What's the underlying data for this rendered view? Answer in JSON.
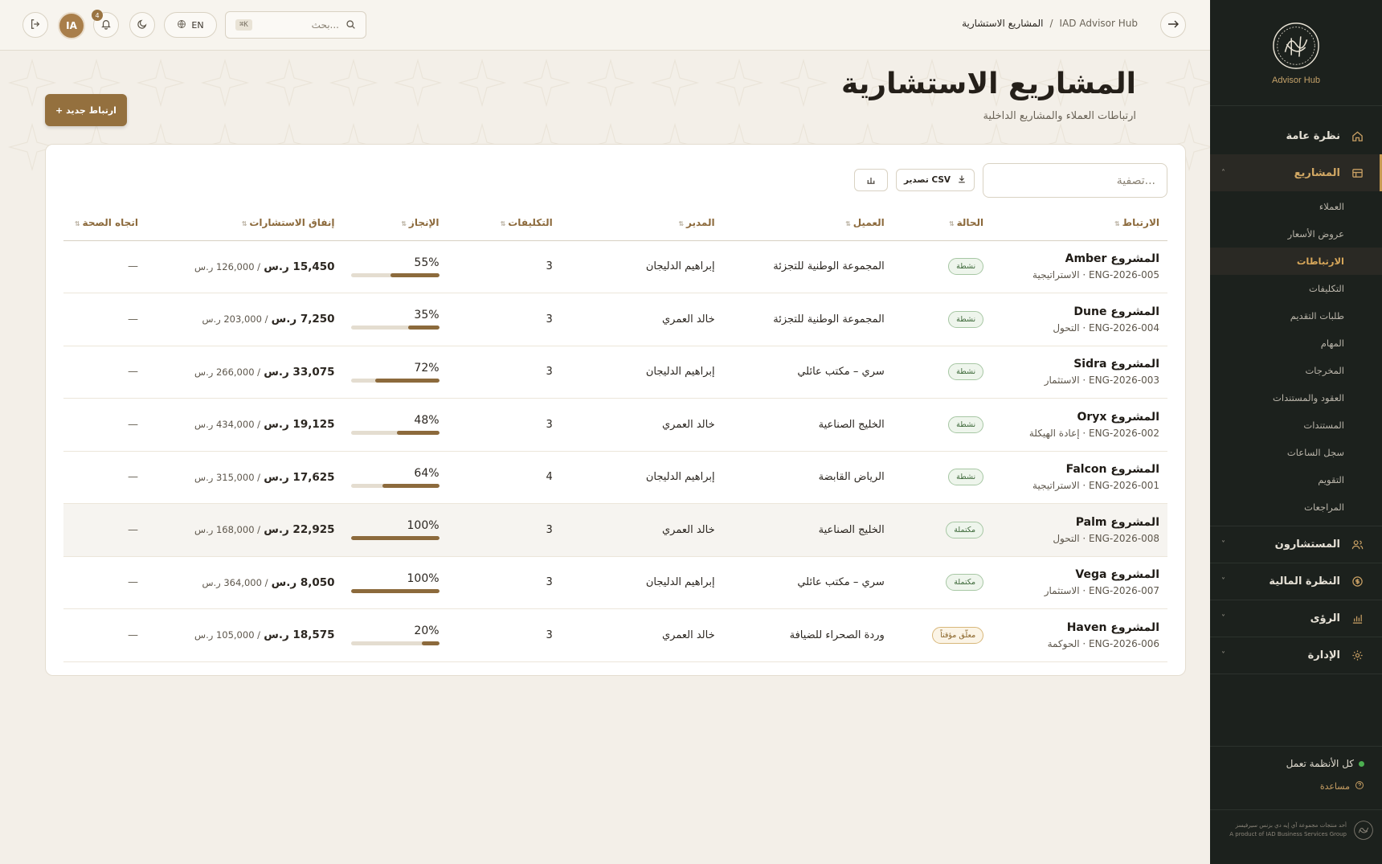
{
  "sidebar": {
    "brand_sub": "Advisor Hub",
    "nav": [
      {
        "label": "نظرة عامة",
        "icon": "home-icon"
      },
      {
        "label": "المشاريع",
        "icon": "projects-icon",
        "active": true
      }
    ],
    "sub_items": [
      {
        "label": "العملاء"
      },
      {
        "label": "عروض الأسعار"
      },
      {
        "label": "الارتباطات",
        "active": true
      },
      {
        "label": "التكليفات"
      },
      {
        "label": "طلبات التقديم"
      },
      {
        "label": "المهام"
      },
      {
        "label": "المخرجات"
      },
      {
        "label": "العقود والمستندات"
      },
      {
        "label": "المستندات"
      },
      {
        "label": "سجل الساعات"
      },
      {
        "label": "التقويم"
      },
      {
        "label": "المراجعات"
      }
    ],
    "groups": [
      {
        "label": "المستشارون",
        "icon": "users-icon"
      },
      {
        "label": "النظرة المالية",
        "icon": "finance-icon"
      },
      {
        "label": "الرؤى",
        "icon": "insights-icon"
      },
      {
        "label": "الإدارة",
        "icon": "admin-icon"
      }
    ],
    "status": "كل الأنظمة تعمل",
    "status_color": "#4caf50",
    "help": "مساعدة",
    "footer_ar": "أحد منتجات مجموعة آي إيه دي بزنس سيرفيسز",
    "footer_en": "A product of IAD Business Services Group"
  },
  "topbar": {
    "breadcrumb_root": "IAD Advisor Hub",
    "breadcrumb_sep": "/",
    "breadcrumb_current": "المشاريع الاستشارية",
    "search_placeholder": "بحث...",
    "search_shortcut": "⌘K",
    "lang": "EN",
    "notifications_count": "4",
    "avatar_initials": "IA"
  },
  "page": {
    "title": "المشاريع الاستشارية",
    "subtitle": "ارتباطات العملاء والمشاريع الداخلية",
    "new_button": "+ ارتباط جديد",
    "filter_placeholder": "تصفية...",
    "export_csv": "تصدير CSV"
  },
  "table": {
    "columns": [
      "الارتباط",
      "الحالة",
      "العميل",
      "المدير",
      "التكليفات",
      "الإنجاز",
      "إنفاق الاستشارات",
      "اتجاه الصحة"
    ],
    "rows": [
      {
        "name": "المشروع Amber",
        "meta": "ENG-2026-005 · الاستراتيجية",
        "status": "نشطة",
        "status_kind": "active",
        "client": "المجموعة الوطنية للتجزئة",
        "manager": "إبراهيم الدليجان",
        "assignments": "3",
        "progress": 55,
        "progress_label": "55%",
        "spend": "15,450 ر.س",
        "budget": "/ 126,000 ر.س",
        "health": "—"
      },
      {
        "name": "المشروع Dune",
        "meta": "ENG-2026-004 · التحول",
        "status": "نشطة",
        "status_kind": "active",
        "client": "المجموعة الوطنية للتجزئة",
        "manager": "خالد العمري",
        "assignments": "3",
        "progress": 35,
        "progress_label": "35%",
        "spend": "7,250 ر.س",
        "budget": "/ 203,000 ر.س",
        "health": "—"
      },
      {
        "name": "المشروع Sidra",
        "meta": "ENG-2026-003 · الاستثمار",
        "status": "نشطة",
        "status_kind": "active",
        "client": "سري – مكتب عائلي",
        "manager": "إبراهيم الدليجان",
        "assignments": "3",
        "progress": 72,
        "progress_label": "72%",
        "spend": "33,075 ر.س",
        "budget": "/ 266,000 ر.س",
        "health": "—"
      },
      {
        "name": "المشروع Oryx",
        "meta": "ENG-2026-002 · إعادة الهيكلة",
        "status": "نشطة",
        "status_kind": "active",
        "client": "الخليج الصناعية",
        "manager": "خالد العمري",
        "assignments": "3",
        "progress": 48,
        "progress_label": "48%",
        "spend": "19,125 ر.س",
        "budget": "/ 434,000 ر.س",
        "health": "—"
      },
      {
        "name": "المشروع Falcon",
        "meta": "ENG-2026-001 · الاستراتيجية",
        "status": "نشطة",
        "status_kind": "active",
        "client": "الرياض القابضة",
        "manager": "إبراهيم الدليجان",
        "assignments": "4",
        "progress": 64,
        "progress_label": "64%",
        "spend": "17,625 ر.س",
        "budget": "/ 315,000 ر.س",
        "health": "—"
      },
      {
        "name": "المشروع Palm",
        "meta": "ENG-2026-008 · التحول",
        "status": "مكتملة",
        "status_kind": "done",
        "client": "الخليج الصناعية",
        "manager": "خالد العمري",
        "assignments": "3",
        "progress": 100,
        "progress_label": "100%",
        "spend": "22,925 ر.س",
        "budget": "/ 168,000 ر.س",
        "health": "—",
        "shaded": true
      },
      {
        "name": "المشروع Vega",
        "meta": "ENG-2026-007 · الاستثمار",
        "status": "مكتملة",
        "status_kind": "done",
        "client": "سري – مكتب عائلي",
        "manager": "إبراهيم الدليجان",
        "assignments": "3",
        "progress": 100,
        "progress_label": "100%",
        "spend": "8,050 ر.س",
        "budget": "/ 364,000 ر.س",
        "health": "—"
      },
      {
        "name": "المشروع Haven",
        "meta": "ENG-2026-006 · الحوكمة",
        "status": "معلّق مؤقتاً",
        "status_kind": "paused",
        "client": "وردة الصحراء للضيافة",
        "manager": "خالد العمري",
        "assignments": "3",
        "progress": 20,
        "progress_label": "20%",
        "spend": "18,575 ر.س",
        "budget": "/ 105,000 ر.س",
        "health": "—"
      }
    ]
  },
  "colors": {
    "accent": "#94703e",
    "sidebar_bg": "#1c211d",
    "page_bg": "#f3efe8"
  }
}
